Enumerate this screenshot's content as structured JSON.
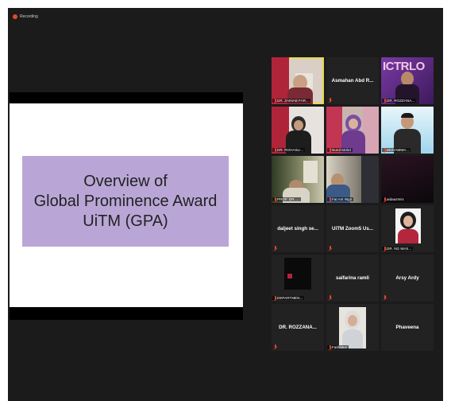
{
  "recording": {
    "label": "Recording"
  },
  "slide": {
    "title": "Overview of\nGlobal Prominence Award\nUiTM (GPA)"
  },
  "participants": [
    {
      "label": "DR. ZAINAB FAR...",
      "video": true
    },
    {
      "name": "Asmahan Abd R...",
      "video": false
    },
    {
      "label": "DR. ROZZANA...",
      "video": true,
      "overlay": "ICTRLO"
    },
    {
      "label": "DR. ROHASLI...",
      "video": true
    },
    {
      "label": "Nurul Mohd",
      "video": true
    },
    {
      "label": "MUHAMMA...",
      "video": true
    },
    {
      "label": "PROF. DR. ...",
      "video": true
    },
    {
      "label": "Fat Ant Wgn",
      "video": true
    },
    {
      "label": "aidaazmirc",
      "video": true
    },
    {
      "name": "daljeet singh se...",
      "video": false
    },
    {
      "name": "UiTM Zoom5 Us...",
      "video": false
    },
    {
      "label": "DR. NG MAS...",
      "video": true
    },
    {
      "label": "DEPARTMEN...",
      "video": true
    },
    {
      "name": "saifarina ramli",
      "video": false
    },
    {
      "name": "Arsy Ardy",
      "video": false
    },
    {
      "name": "DR. ROZZANA...",
      "video": false
    },
    {
      "label": "Fatihatun",
      "video": true
    },
    {
      "name": "Phaveena",
      "video": false
    }
  ],
  "colors": {
    "mute_icon": "#e8452b",
    "active_speaker_border": "#e8d94a",
    "slide_box": "#b9a6d6"
  }
}
